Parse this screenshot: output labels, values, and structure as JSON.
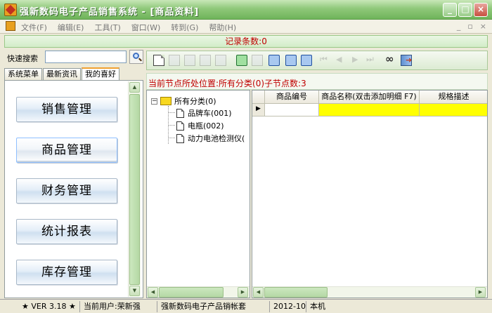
{
  "window": {
    "title": "强新数码电子产品销售系统 - [商品资料]",
    "minimize_glyph": "_",
    "maximize_glyph": "□",
    "close_glyph": "×"
  },
  "menu": {
    "items": [
      "文件(F)",
      "编辑(E)",
      "工具(T)",
      "窗口(W)",
      "转到(G)",
      "帮助(H)"
    ],
    "mdi_controls": [
      "_",
      "▫",
      "×"
    ]
  },
  "record_bar": {
    "text": "记录条数:0"
  },
  "left": {
    "quick_search_label": "快速搜索",
    "quick_search_value": "",
    "tabs": [
      {
        "label": "系统菜单",
        "active": false
      },
      {
        "label": "最新资讯",
        "active": false
      },
      {
        "label": "我的喜好",
        "active": true
      }
    ],
    "nav_buttons": [
      "销售管理",
      "商品管理",
      "财务管理",
      "统计报表",
      "库存管理"
    ],
    "selected_nav": "商品管理"
  },
  "toolbar": {
    "icons": [
      "new-icon",
      "edit-icon",
      "delete-icon",
      "save-icon",
      "undo-icon",
      "refresh-icon",
      "import-icon",
      "preview-icon",
      "print-icon",
      "export-icon",
      "first-icon",
      "prev-icon",
      "next-icon",
      "last-icon",
      "glasses-icon",
      "exit-icon"
    ]
  },
  "location": {
    "text": "当前节点所处位置:所有分类(0)子节点数:3"
  },
  "tree": {
    "root": "所有分类(0)",
    "expander": "−",
    "children": [
      "品牌车(001)",
      "电瓶(002)",
      "动力电池检测仪("
    ]
  },
  "grid": {
    "columns": [
      "商品编号",
      "商品名称(双击添加明细 F7)",
      "规格描述"
    ]
  },
  "status": {
    "version": "★ VER 3.18 ★",
    "current_user": "当前用户:荣新强",
    "account": "强新数码电子产品销帐套",
    "period": "2012-10",
    "machine": "本机"
  },
  "colors": {
    "title_green": "#6fb45a",
    "record_text": "#c00000",
    "selected_cell": "#ffff00"
  }
}
